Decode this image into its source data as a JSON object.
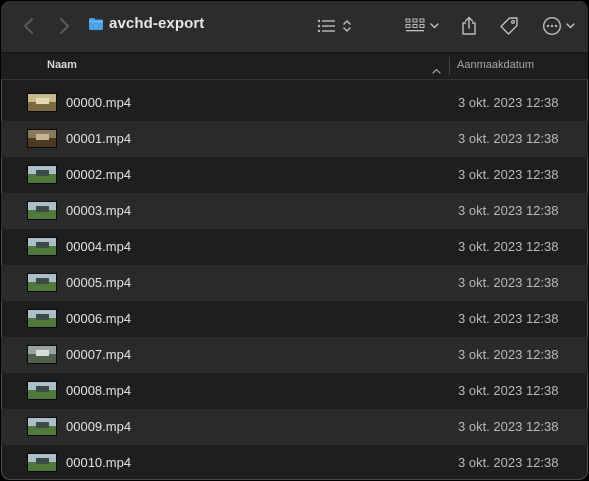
{
  "window": {
    "title": "avchd-export"
  },
  "toolbar": {
    "back_icon": "chevron-left-icon",
    "forward_icon": "chevron-right-icon",
    "folder_icon": "folder-icon",
    "list_view_icon": "list-view-icon",
    "group_icon": "grid-group-icon",
    "share_icon": "share-icon",
    "tag_icon": "tag-icon",
    "more_icon": "ellipsis-circle-icon"
  },
  "columns": {
    "name": "Naam",
    "date": "Aanmaakdatum"
  },
  "files": [
    {
      "name": "00000.mp4",
      "date": "3 okt. 2023 12:38",
      "thumb": "beige"
    },
    {
      "name": "00001.mp4",
      "date": "3 okt. 2023 12:38",
      "thumb": "brown"
    },
    {
      "name": "00002.mp4",
      "date": "3 okt. 2023 12:38",
      "thumb": "green"
    },
    {
      "name": "00003.mp4",
      "date": "3 okt. 2023 12:38",
      "thumb": "green"
    },
    {
      "name": "00004.mp4",
      "date": "3 okt. 2023 12:38",
      "thumb": "green"
    },
    {
      "name": "00005.mp4",
      "date": "3 okt. 2023 12:38",
      "thumb": "green"
    },
    {
      "name": "00006.mp4",
      "date": "3 okt. 2023 12:38",
      "thumb": "green"
    },
    {
      "name": "00007.mp4",
      "date": "3 okt. 2023 12:38",
      "thumb": "gray"
    },
    {
      "name": "00008.mp4",
      "date": "3 okt. 2023 12:38",
      "thumb": "green"
    },
    {
      "name": "00009.mp4",
      "date": "3 okt. 2023 12:38",
      "thumb": "green"
    },
    {
      "name": "00010.mp4",
      "date": "3 okt. 2023 12:38",
      "thumb": "green"
    }
  ],
  "colors": {
    "window_bg": "#1e1e1e",
    "toolbar_bg": "#2c2c2c",
    "row_alt_bg": "#2a2a2a",
    "folder_blue": "#4ea3e8"
  }
}
